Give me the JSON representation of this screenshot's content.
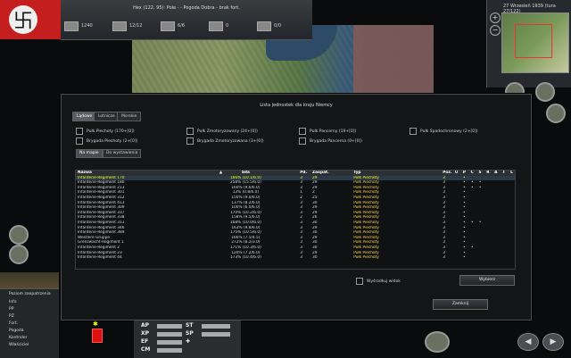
{
  "topbar": {
    "hex_info": "Hex (122, 95): Pole - - Pogoda Dobra - brak fort.",
    "resources": [
      "1240",
      "12/12",
      "6/6",
      "0",
      "0/0"
    ]
  },
  "minimap": {
    "date": "27 Wrzesień 1939 (tura 27/122)"
  },
  "dialog": {
    "title": "Lista jednostek dla kraju Niemcy",
    "tabs": [
      "Lądowe",
      "Lotnicze",
      "Morskie"
    ],
    "filters": [
      "Pułk Piechoty (170+[0])",
      "Pułk Zmotoryzowany (24+[0])",
      "Pułk Pancerny (19+[0])",
      "Pułk Spadochronowy (2+[0])",
      "Brygada Piechoty (2+[0])",
      "Brygada Zmotoryzowana (3+[0])",
      "Brygada Pancerna (0+[0])"
    ],
    "subtabs": [
      "Na mapie",
      "Do wystawienia"
    ],
    "columns": [
      "Nazwa",
      "Siła",
      "Pd.",
      "Zaopat.",
      "Typ",
      "Poz.",
      "U",
      "P",
      "C",
      "S",
      "R",
      "A",
      "T",
      "L"
    ],
    "rows": [
      [
        "Infanterie-Regiment 170",
        "166% (10.1/6.0)",
        "3",
        "29",
        "Pułk Piechoty",
        "3",
        "",
        "•",
        "",
        "",
        "",
        "",
        "",
        ""
      ],
      [
        "Infanterie-Regiment 180",
        "258% (15.5/6.0)",
        "3",
        "29",
        "Pułk Piechoty",
        "3",
        "",
        "•",
        "•",
        "•",
        "",
        "",
        "",
        ""
      ],
      [
        "Infanterie-Regiment 213",
        "160% (9.6/6.0)",
        "3",
        "29",
        "Pułk Piechoty",
        "3",
        "",
        "•",
        "•",
        "•",
        "",
        "",
        "",
        ""
      ],
      [
        "Infanterie-Regiment 301",
        "13% (0.8/6.0)",
        "1",
        "2",
        "Pułk Piechoty",
        "3",
        "",
        "•",
        "",
        "",
        "",
        "",
        "",
        ""
      ],
      [
        "Infanterie-Regiment 312",
        "150% (9.0/6.0)",
        "2",
        "25",
        "Pułk Piechoty",
        "3",
        "",
        "•",
        "",
        "",
        "",
        "",
        "",
        ""
      ],
      [
        "Infanterie-Regiment 413",
        "137% (8.2/6.0)",
        "3",
        "30",
        "Pułk Piechoty",
        "3",
        "",
        "•",
        "",
        "",
        "",
        "",
        "",
        ""
      ],
      [
        "Infanterie-Regiment 309",
        "100% (6.0/6.0)",
        "3",
        "29",
        "Pułk Piechoty",
        "3",
        "",
        "•",
        "",
        "",
        "",
        "",
        "",
        ""
      ],
      [
        "Infanterie-Regiment 337",
        "170% (10.2/6.0)",
        "3",
        "29",
        "Pułk Piechoty",
        "3",
        "",
        "•",
        "",
        "",
        "",
        "",
        "",
        ""
      ],
      [
        "Infanterie-Regiment 338",
        "158% (9.5/6.0)",
        "2",
        "26",
        "Pułk Piechoty",
        "3",
        "",
        "•",
        "",
        "",
        "",
        "",
        "",
        ""
      ],
      [
        "Infanterie-Regiment 311",
        "168% (10.0/6.0)",
        "3",
        "30",
        "Pułk Piechoty",
        "3",
        "",
        "•",
        "•",
        "•",
        "",
        "",
        "",
        ""
      ],
      [
        "Infanterie-Regiment 346",
        "163% (9.8/6.0)",
        "3",
        "29",
        "Pułk Piechoty",
        "3",
        "",
        "•",
        "",
        "",
        "",
        "",
        "",
        ""
      ],
      [
        "Infanterie-Regiment 389",
        "175% (10.5/6.0)",
        "3",
        "30",
        "Pułk Piechoty",
        "3",
        "",
        "•",
        "",
        "",
        "",
        "",
        "",
        ""
      ],
      [
        "Westlere Gruppe",
        "166% (7.5/4.5)",
        "3",
        "29",
        "Pułk Piechoty",
        "3",
        "",
        "•",
        "",
        "",
        "",
        "",
        "",
        ""
      ],
      [
        "Grenzwacht-Regiment 1",
        "272% (8.2/3.0)",
        "3",
        "30",
        "Pułk Piechoty",
        "3",
        "",
        "•",
        "",
        "",
        "",
        "",
        "",
        ""
      ],
      [
        "Infanterie-Regiment 2",
        "171% (10.3/6.0)",
        "3",
        "30",
        "Pułk Piechoty",
        "3",
        "",
        "•",
        "•",
        "",
        "",
        "",
        "",
        ""
      ],
      [
        "Infanterie-Regiment 23",
        "120% (7.2/6.0)",
        "3",
        "29",
        "Pułk Piechoty",
        "3",
        "",
        "•",
        "",
        "",
        "",
        "",
        "",
        ""
      ],
      [
        "Infanterie-Regiment 44",
        "173% (10.4/6.0)",
        "3",
        "30",
        "Pułk Piechoty",
        "3",
        "",
        "•",
        "",
        "",
        "",
        "",
        "",
        ""
      ]
    ],
    "checkbox_label": "Wyśrodkuj widok",
    "select_button": "Wybierz",
    "close_button": "Zamknij"
  },
  "leftpanel": {
    "header": "Poziom zaopatrzenia",
    "items": [
      "Info",
      "PP",
      "PZ",
      "Fort.",
      "Pogoda",
      "Kontroler",
      "Właściciel"
    ]
  },
  "bottom_stats": [
    "AP",
    "XP",
    "EF",
    "CM",
    "ST",
    "SP"
  ]
}
